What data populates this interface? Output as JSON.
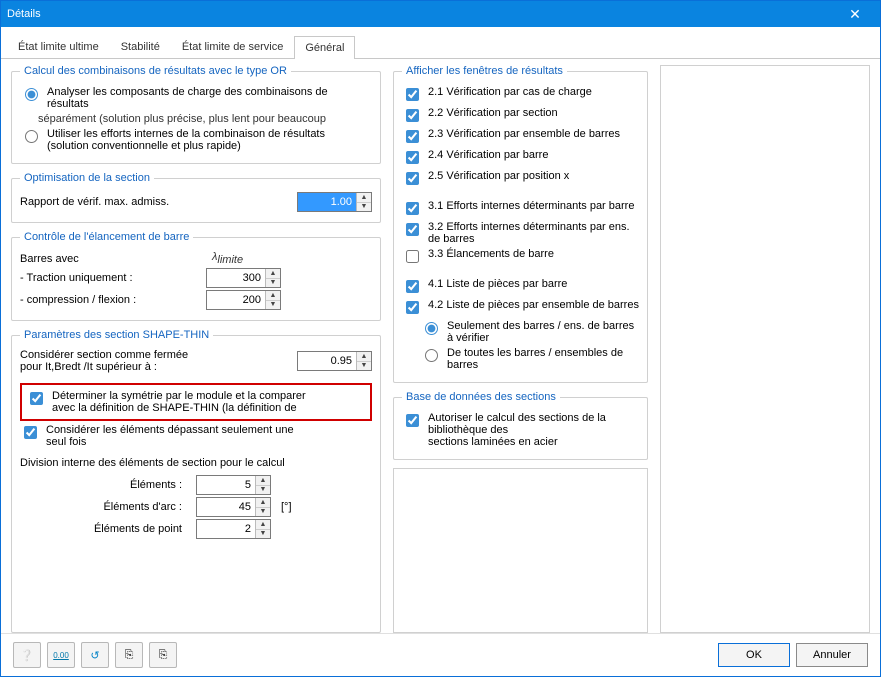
{
  "window": {
    "title": "Détails"
  },
  "tabs": [
    {
      "label": "État limite ultime"
    },
    {
      "label": "Stabilité"
    },
    {
      "label": "État limite de service"
    },
    {
      "label": "Général"
    }
  ],
  "left": {
    "calc_or": {
      "legend": "Calcul des combinaisons de résultats avec le type OR",
      "opt1_line1": "Analyser les composants de charge des combinaisons de",
      "opt1_line2": "résultats",
      "opt1_sub": "séparément (solution plus précise, plus lent pour beaucoup",
      "opt2": "Utiliser les efforts internes de la combinaison de résultats",
      "opt2_sub": "(solution conventionnelle et plus rapide)"
    },
    "optim": {
      "legend": "Optimisation de la section",
      "ratio_label": "Rapport de vérif. max. admiss.",
      "ratio_value": "1.00"
    },
    "slender": {
      "legend": "Contrôle de l'élancement de barre",
      "members_with": "Barres avec",
      "lambda": "λ",
      "lambda_sub": "limite",
      "traction_label": "- Traction uniquement :",
      "traction_value": "300",
      "compression_label": "- compression / flexion :",
      "compression_value": "200"
    },
    "shapethin": {
      "legend": "Paramètres des section SHAPE-THIN",
      "closed_l1": "Considérer section comme fermée",
      "closed_l2": "pour It,Bredt /It supérieur à :",
      "closed_value": "0.95",
      "sym_l1": "Déterminer la symétrie par le module et la comparer",
      "sym_l2": "avec la définition de SHAPE-THIN (la définition de",
      "protrude_l1": "Considérer les éléments dépassant seulement une",
      "protrude_l2": "seul fois",
      "division_heading": "Division interne des éléments de section pour le calcul",
      "elements_label": "Éléments :",
      "elements_value": "5",
      "arc_label": "Éléments d'arc :",
      "arc_value": "45",
      "arc_unit": "[°]",
      "point_label": "Éléments de point",
      "point_value": "2"
    }
  },
  "mid": {
    "results": {
      "legend": "Afficher les fenêtres de résultats",
      "c21": "2.1 Vérification par cas de charge",
      "c22": "2.2 Vérification par section",
      "c23": "2.3 Vérification par ensemble de barres",
      "c24": "2.4 Vérification par barre",
      "c25": "2.5 Vérification par position x",
      "c31": "3.1 Efforts internes déterminants par barre",
      "c32": "3.2 Efforts internes déterminants par ens. de barres",
      "c33": "3.3 Élancements de barre",
      "c41": "4.1 Liste de pièces par barre",
      "c42": "4.2 Liste de pièces par ensemble de barres",
      "r_only": "Seulement des barres / ens. de barres à vérifier",
      "r_all": "De toutes les barres / ensembles de barres"
    },
    "db": {
      "legend": "Base de données des sections",
      "allow_l1": "Autoriser le calcul des sections de la bibliothèque des",
      "allow_l2": "sections laminées en acier"
    }
  },
  "footer": {
    "ok": "OK",
    "cancel": "Annuler"
  },
  "icons": {
    "help": "❔",
    "precision": "0.00",
    "reset": "↺",
    "prof1": "⎘",
    "prof2": "⎘"
  }
}
